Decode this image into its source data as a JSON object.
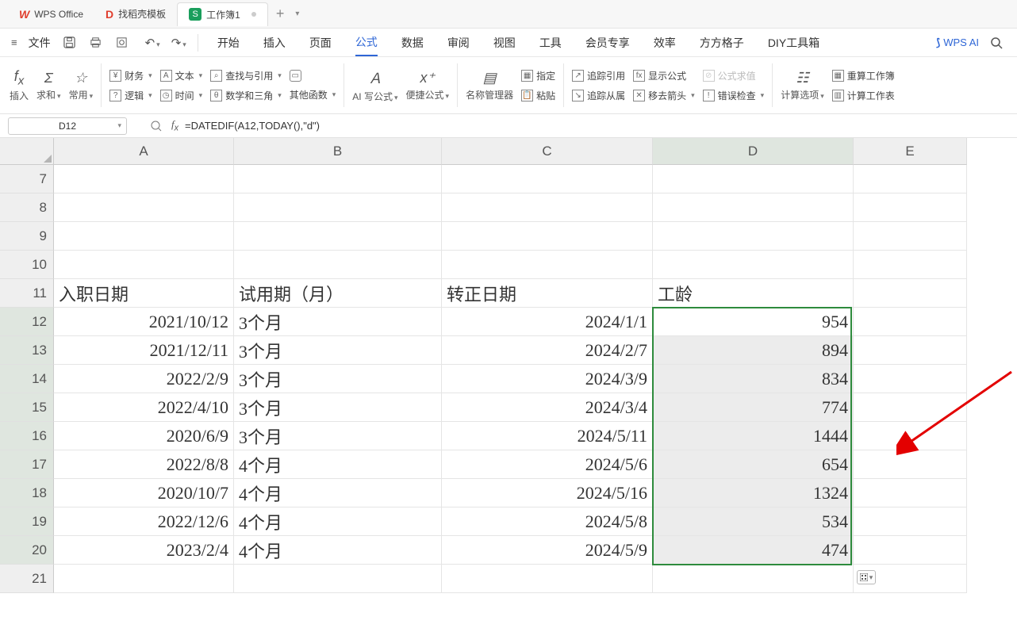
{
  "app": {
    "name": "WPS Office"
  },
  "tabs": [
    {
      "label": "找稻壳模板"
    },
    {
      "label": "工作簿1"
    }
  ],
  "menu": {
    "file": "文件",
    "items": [
      "开始",
      "插入",
      "页面",
      "公式",
      "数据",
      "审阅",
      "视图",
      "工具",
      "会员专享",
      "效率",
      "方方格子",
      "DIY工具箱"
    ],
    "active": "公式",
    "ai": "WPS AI"
  },
  "ribbon": {
    "fx": "插入",
    "sum": "求和",
    "star": "常用",
    "caiwu": "财务",
    "wenben": "文本",
    "chazhao": "查找与引用",
    "luoji": "逻辑",
    "shijian": "时间",
    "shuxue": "数学和三角",
    "qita": "其他函数",
    "ai_formula": "AI 写公式",
    "quick": "便捷公式",
    "nameMgr": "名称管理器",
    "zhiding": "指定",
    "zhantie": "粘贴",
    "zhuizong": "追踪引用",
    "zhuizongcong": "追踪从属",
    "xianshigongshi": "显示公式",
    "yichu": "移去箭头",
    "gsqz": "公式求值",
    "cwjc": "错误检查",
    "jsxx": "计算选项",
    "czgzb": "重算工作簿",
    "jsgzb": "计算工作表"
  },
  "namebox": "D12",
  "formula": "=DATEDIF(A12,TODAY(),\"d\")",
  "columns": [
    "A",
    "B",
    "C",
    "D",
    "E"
  ],
  "row_nums": [
    7,
    8,
    9,
    10,
    11,
    12,
    13,
    14,
    15,
    16,
    17,
    18,
    19,
    20,
    21
  ],
  "headers": {
    "A": "入职日期",
    "B": "试用期（月）",
    "C": "转正日期",
    "D": "工龄"
  },
  "rows": [
    {
      "A": "2021/10/12",
      "B": "3个月",
      "C": "2024/1/1",
      "D": "954"
    },
    {
      "A": "2021/12/11",
      "B": "3个月",
      "C": "2024/2/7",
      "D": "894"
    },
    {
      "A": "2022/2/9",
      "B": "3个月",
      "C": "2024/3/9",
      "D": "834"
    },
    {
      "A": "2022/4/10",
      "B": "3个月",
      "C": "2024/3/4",
      "D": "774"
    },
    {
      "A": "2020/6/9",
      "B": "3个月",
      "C": "2024/5/11",
      "D": "1444"
    },
    {
      "A": "2022/8/8",
      "B": "4个月",
      "C": "2024/5/6",
      "D": "654"
    },
    {
      "A": "2020/10/7",
      "B": "4个月",
      "C": "2024/5/16",
      "D": "1324"
    },
    {
      "A": "2022/12/6",
      "B": "4个月",
      "C": "2024/5/8",
      "D": "534"
    },
    {
      "A": "2023/2/4",
      "B": "4个月",
      "C": "2024/5/9",
      "D": "474"
    }
  ]
}
